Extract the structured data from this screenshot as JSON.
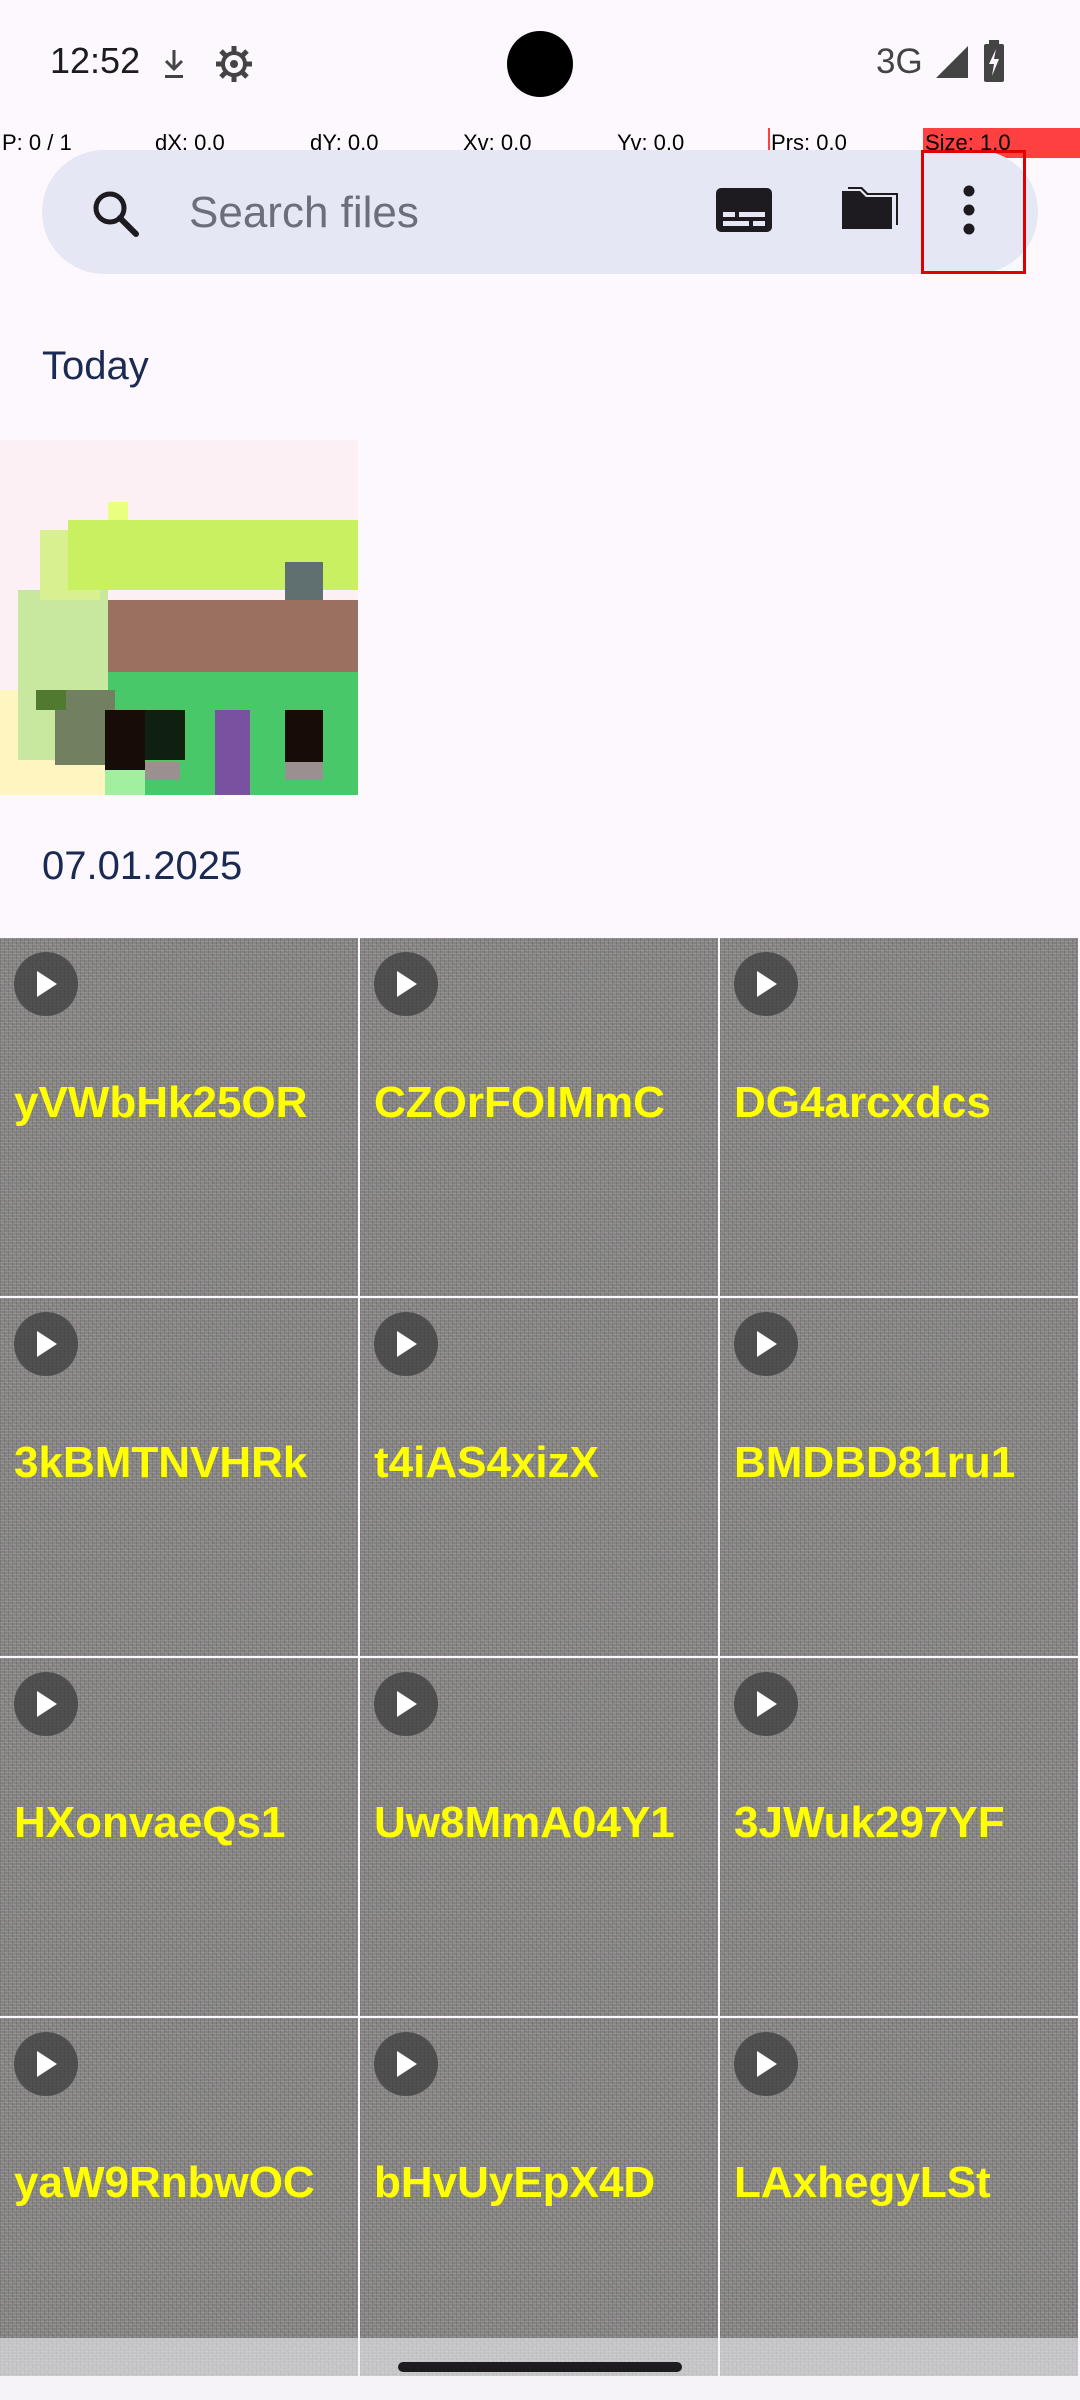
{
  "status_bar": {
    "time": "12:52",
    "network": "3G",
    "icons": [
      "download-icon",
      "settings-gear-icon",
      "signal-icon",
      "battery-charging-icon"
    ]
  },
  "pointer_overlay": {
    "p": "P: 0 / 1",
    "dx": "dX: 0.0",
    "dy": "dY: 0.0",
    "xv": "Xv: 0.0",
    "yv": "Yv: 0.0",
    "prs": "Prs: 0.0",
    "size": "Size: 1.0"
  },
  "search": {
    "placeholder": "Search files",
    "icons": [
      "search-icon",
      "subtitles-icon",
      "folder-icon",
      "more-vert-icon"
    ]
  },
  "sections": [
    {
      "title": "Today"
    },
    {
      "title": "07.01.2025"
    }
  ],
  "videos": [
    "yVWbHk25OR",
    "CZOrFOIMmC",
    "DG4arcxdcs",
    "3kBMTNVHRk",
    "t4iAS4xizX",
    "BMDBD81ru1",
    "HXonvaeQs1",
    "Uw8MmA04Y1",
    "3JWuk297YF",
    "yaW9RnbwOC",
    "bHvUyEpX4D",
    "LAxhegyLSt"
  ],
  "colors": {
    "background": "#fcf8fd",
    "search_bar": "#e6e7f4",
    "section_title": "#1a2a52",
    "video_label": "#ffff00",
    "highlight": "#e00000"
  }
}
